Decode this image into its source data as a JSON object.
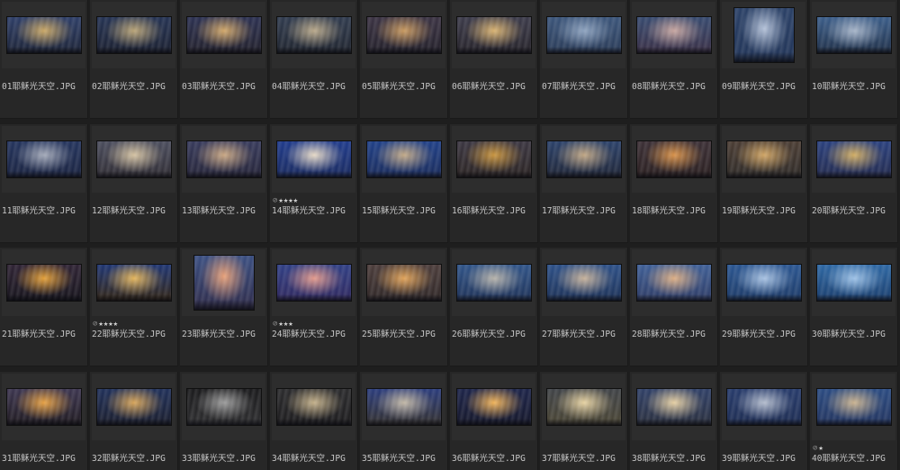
{
  "images": [
    {
      "name": "01耶稣光天空.JPG",
      "stars": 0,
      "reject": false,
      "shape": "wide",
      "c1": "#2d3d66",
      "c2": "#caa866",
      "c3": "#1d2437"
    },
    {
      "name": "02耶稣光天空.JPG",
      "stars": 0,
      "reject": false,
      "shape": "wide",
      "c1": "#243252",
      "c2": "#b9a477",
      "c3": "#1b2030"
    },
    {
      "name": "03耶稣光天空.JPG",
      "stars": 0,
      "reject": false,
      "shape": "wide",
      "c1": "#2b3050",
      "c2": "#d2a86a",
      "c3": "#22202b"
    },
    {
      "name": "04耶稣光天空.JPG",
      "stars": 0,
      "reject": false,
      "shape": "wide",
      "c1": "#2f3a4d",
      "c2": "#b8a88a",
      "c3": "#20252f"
    },
    {
      "name": "05耶稣光天空.JPG",
      "stars": 0,
      "reject": false,
      "shape": "wide",
      "c1": "#3a3242",
      "c2": "#c99a60",
      "c3": "#23202a"
    },
    {
      "name": "06耶稣光天空.JPG",
      "stars": 0,
      "reject": false,
      "shape": "wide",
      "c1": "#3b3a49",
      "c2": "#d9b372",
      "c3": "#26232a"
    },
    {
      "name": "07耶稣光天空.JPG",
      "stars": 0,
      "reject": false,
      "shape": "wide",
      "c1": "#3a5479",
      "c2": "#8ea3bf",
      "c3": "#2a3b57"
    },
    {
      "name": "08耶稣光天空.JPG",
      "stars": 0,
      "reject": false,
      "shape": "wide",
      "c1": "#36496e",
      "c2": "#c7a6a0",
      "c3": "#3a2f45"
    },
    {
      "name": "09耶稣光天空.JPG",
      "stars": 0,
      "reject": false,
      "shape": "tall",
      "c1": "#2a4066",
      "c2": "#b3c1d8",
      "c3": "#213457"
    },
    {
      "name": "10耶稣光天空.JPG",
      "stars": 0,
      "reject": false,
      "shape": "wide",
      "c1": "#3a5c88",
      "c2": "#a6b4c8",
      "c3": "#203048"
    },
    {
      "name": "11耶稣光天空.JPG",
      "stars": 0,
      "reject": false,
      "shape": "wide",
      "c1": "#23335c",
      "c2": "#a3a9b8",
      "c3": "#1a2340"
    },
    {
      "name": "12耶稣光天空.JPG",
      "stars": 0,
      "reject": false,
      "shape": "wide",
      "c1": "#4a4c5c",
      "c2": "#d4c2a2",
      "c3": "#2f2c33"
    },
    {
      "name": "13耶稣光天空.JPG",
      "stars": 0,
      "reject": false,
      "shape": "wide",
      "c1": "#36395a",
      "c2": "#c9a783",
      "c3": "#252438"
    },
    {
      "name": "14耶稣光天空.JPG",
      "stars": 4,
      "reject": true,
      "shape": "wide",
      "c1": "#1f3a8a",
      "c2": "#e6d9c6",
      "c3": "#1a2a5e"
    },
    {
      "name": "15耶稣光天空.JPG",
      "stars": 0,
      "reject": false,
      "shape": "wide",
      "c1": "#1f3f86",
      "c2": "#c2a987",
      "c3": "#1a2b5a"
    },
    {
      "name": "16耶稣光天空.JPG",
      "stars": 0,
      "reject": false,
      "shape": "wide",
      "c1": "#3a3540",
      "c2": "#c9953f",
      "c3": "#2a2322"
    },
    {
      "name": "17耶稣光天空.JPG",
      "stars": 0,
      "reject": false,
      "shape": "wide",
      "c1": "#2a4068",
      "c2": "#c0a684",
      "c3": "#1f2536"
    },
    {
      "name": "18耶稣光天空.JPG",
      "stars": 0,
      "reject": false,
      "shape": "wide",
      "c1": "#3b2f35",
      "c2": "#d8924a",
      "c3": "#2a1f20"
    },
    {
      "name": "19耶稣光天空.JPG",
      "stars": 0,
      "reject": false,
      "shape": "wide",
      "c1": "#4a3c33",
      "c2": "#d0a565",
      "c3": "#2e2a27"
    },
    {
      "name": "20耶稣光天空.JPG",
      "stars": 0,
      "reject": false,
      "shape": "wide",
      "c1": "#293f7c",
      "c2": "#d1ad63",
      "c3": "#232a4d"
    },
    {
      "name": "21耶稣光天空.JPG",
      "stars": 0,
      "reject": false,
      "shape": "wide",
      "c1": "#2e2233",
      "c2": "#e3a03a",
      "c3": "#16141c"
    },
    {
      "name": "22耶稣光天空.JPG",
      "stars": 4,
      "reject": true,
      "shape": "wide",
      "c1": "#1e3470",
      "c2": "#e3b55c",
      "c3": "#332616"
    },
    {
      "name": "23耶稣光天空.JPG",
      "stars": 0,
      "reject": false,
      "shape": "tall",
      "c1": "#3a4e80",
      "c2": "#e7a078",
      "c3": "#2e2a48"
    },
    {
      "name": "24耶稣光天空.JPG",
      "stars": 3,
      "reject": true,
      "shape": "wide",
      "c1": "#2f3e83",
      "c2": "#e39a8c",
      "c3": "#30285e"
    },
    {
      "name": "25耶稣光天空.JPG",
      "stars": 0,
      "reject": false,
      "shape": "wide",
      "c1": "#4b3c3a",
      "c2": "#e0a35a",
      "c3": "#2f2727"
    },
    {
      "name": "26耶稣光天空.JPG",
      "stars": 0,
      "reject": false,
      "shape": "wide",
      "c1": "#2f5387",
      "c2": "#b6b2aa",
      "c3": "#1f3257"
    },
    {
      "name": "27耶稣光天空.JPG",
      "stars": 0,
      "reject": false,
      "shape": "wide",
      "c1": "#2c4f86",
      "c2": "#c6b19a",
      "c3": "#1d3156"
    },
    {
      "name": "28耶稣光天空.JPG",
      "stars": 0,
      "reject": false,
      "shape": "wide",
      "c1": "#3e5e95",
      "c2": "#dcae84",
      "c3": "#2e3b64"
    },
    {
      "name": "29耶稣光天空.JPG",
      "stars": 0,
      "reject": false,
      "shape": "wide",
      "c1": "#2a5590",
      "c2": "#a8c2e2",
      "c3": "#1d3a66"
    },
    {
      "name": "30耶稣光天空.JPG",
      "stars": 0,
      "reject": false,
      "shape": "wide",
      "c1": "#2d67a3",
      "c2": "#9dc1e6",
      "c3": "#1a3d6c"
    },
    {
      "name": "31耶稣光天空.JPG",
      "stars": 0,
      "reject": false,
      "shape": "wide",
      "c1": "#3b344e",
      "c2": "#e6a144",
      "c3": "#1f1a20"
    },
    {
      "name": "32耶稣光天空.JPG",
      "stars": 0,
      "reject": false,
      "shape": "wide",
      "c1": "#1f2f58",
      "c2": "#d7a55a",
      "c3": "#1a1d2c"
    },
    {
      "name": "33耶稣光天空.JPG",
      "stars": 0,
      "reject": false,
      "shape": "wide",
      "c1": "#1a1a1c",
      "c2": "#9b9b9b",
      "c3": "#2e2e30"
    },
    {
      "name": "34耶稣光天空.JPG",
      "stars": 0,
      "reject": false,
      "shape": "wide",
      "c1": "#2a2a2c",
      "c2": "#c3b08a",
      "c3": "#1d1c1e"
    },
    {
      "name": "35耶稣光天空.JPG",
      "stars": 0,
      "reject": false,
      "shape": "wide",
      "c1": "#2a3b7a",
      "c2": "#c1b7a6",
      "c3": "#33302e"
    },
    {
      "name": "36耶稣光天空.JPG",
      "stars": 0,
      "reject": false,
      "shape": "wide",
      "c1": "#1c2348",
      "c2": "#f0b35a",
      "c3": "#15172a"
    },
    {
      "name": "37耶稣光天空.JPG",
      "stars": 0,
      "reject": false,
      "shape": "wide",
      "c1": "#3f4246",
      "c2": "#e6d2a2",
      "c3": "#4a4534"
    },
    {
      "name": "38耶稣光天空.JPG",
      "stars": 0,
      "reject": false,
      "shape": "wide",
      "c1": "#2f3f66",
      "c2": "#e5cfa3",
      "c3": "#2a2f3d"
    },
    {
      "name": "39耶稣光天空.JPG",
      "stars": 0,
      "reject": false,
      "shape": "wide",
      "c1": "#263a6a",
      "c2": "#b3bccd",
      "c3": "#1e2d52"
    },
    {
      "name": "40耶稣光天空.JPG",
      "stars": 1,
      "reject": true,
      "shape": "wide",
      "c1": "#2a4a80",
      "c2": "#c9b28f",
      "c3": "#23345e"
    }
  ],
  "symbols": {
    "star": "★",
    "reject": "⊘"
  }
}
